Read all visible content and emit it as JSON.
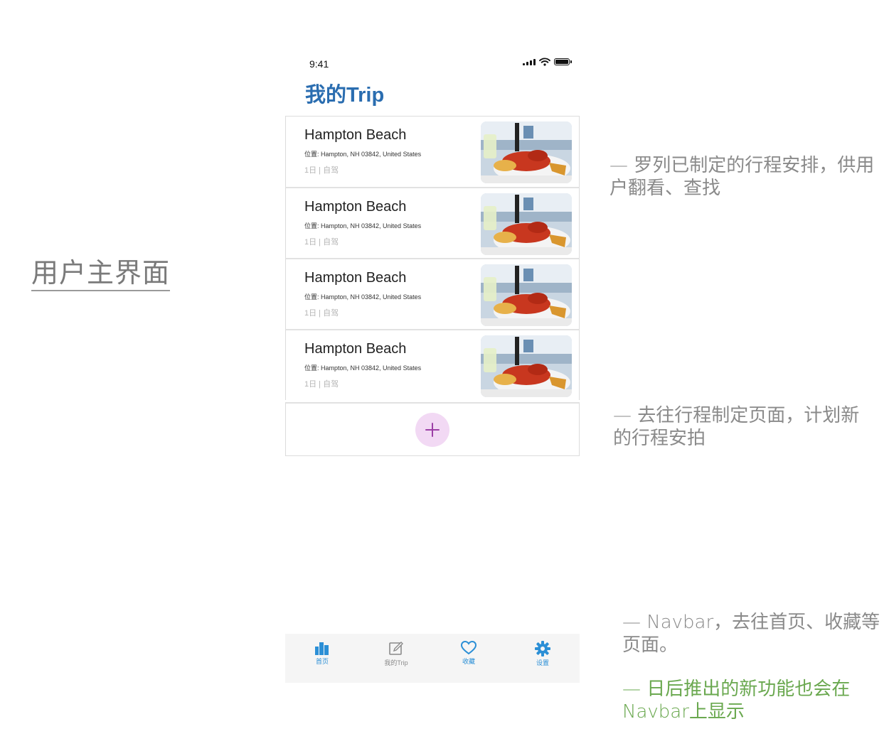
{
  "page_label": "用户主界面",
  "annotations": {
    "list_note": "— 罗列已制定的行程安排，供用户翻看、查找",
    "add_note": "— 去往行程制定页面，计划新的行程安拍",
    "navbar_note": "— Navbar，去往首页、收藏等页面。",
    "future_note": "— 日后推出的新功能也会在Navbar上显示"
  },
  "status_bar": {
    "time": "9:41"
  },
  "app_title": "我的Trip",
  "trips": [
    {
      "name": "Hampton Beach",
      "location": "位置: Hampton, NH 03842, United States",
      "meta": "1日 | 自驾"
    },
    {
      "name": "Hampton Beach",
      "location": "位置: Hampton, NH 03842, United States",
      "meta": "1日 | 自驾"
    },
    {
      "name": "Hampton Beach",
      "location": "位置: Hampton, NH 03842, United States",
      "meta": "1日 | 自驾"
    },
    {
      "name": "Hampton Beach",
      "location": "位置: Hampton, NH 03842, United States",
      "meta": "1日 | 自驾"
    }
  ],
  "add_button": {
    "icon": "plus-icon"
  },
  "navbar": {
    "items": [
      {
        "label": "首页",
        "icon": "buildings-icon",
        "color": "#2b8fd6"
      },
      {
        "label": "我的Trip",
        "icon": "edit-icon",
        "color": "#8a8a8a"
      },
      {
        "label": "收藏",
        "icon": "heart-icon",
        "color": "#2b8fd6"
      },
      {
        "label": "设置",
        "icon": "gear-icon",
        "color": "#2b8fd6"
      }
    ]
  },
  "colors": {
    "title": "#2a6db0",
    "add_button_bg": "#f2d9f4",
    "add_button_fg": "#9c3fa6",
    "future_note": "#6aa84f"
  }
}
